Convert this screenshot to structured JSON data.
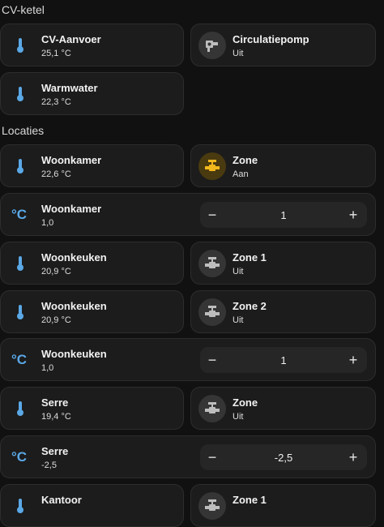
{
  "sections": {
    "cv_ketel": "CV-ketel",
    "locaties": "Locaties"
  },
  "cards": {
    "cv_aanvoer": {
      "name": "CV-Aanvoer",
      "state": "25,1 °C",
      "icon": "thermometer-icon"
    },
    "circulatiepomp": {
      "name": "Circulatiepomp",
      "state": "Uit",
      "icon": "pump-icon"
    },
    "warmwater": {
      "name": "Warmwater",
      "state": "22,3 °C",
      "icon": "thermometer-icon"
    },
    "woonkamer_temp": {
      "name": "Woonkamer",
      "state": "22,6 °C",
      "icon": "thermometer-icon"
    },
    "woonkamer_zone": {
      "name": "Zone",
      "state": "Aan",
      "icon": "valve-icon"
    },
    "woonkamer_offset": {
      "name": "Woonkamer",
      "state": "1,0",
      "icon": "celsius-icon",
      "value": "1"
    },
    "woonkeuken_temp1": {
      "name": "Woonkeuken",
      "state": "20,9 °C",
      "icon": "thermometer-icon"
    },
    "woonkeuken_zone1": {
      "name": "Zone 1",
      "state": "Uit",
      "icon": "valve-icon"
    },
    "woonkeuken_temp2": {
      "name": "Woonkeuken",
      "state": "20,9 °C",
      "icon": "thermometer-icon"
    },
    "woonkeuken_zone2": {
      "name": "Zone 2",
      "state": "Uit",
      "icon": "valve-icon"
    },
    "woonkeuken_offset": {
      "name": "Woonkeuken",
      "state": "1,0",
      "icon": "celsius-icon",
      "value": "1"
    },
    "serre_temp": {
      "name": "Serre",
      "state": "19,4 °C",
      "icon": "thermometer-icon"
    },
    "serre_zone": {
      "name": "Zone",
      "state": "Uit",
      "icon": "valve-icon"
    },
    "serre_offset": {
      "name": "Serre",
      "state": "-2,5",
      "icon": "celsius-icon",
      "value": "-2,5"
    },
    "kantoor_temp": {
      "name": "Kantoor",
      "state": "",
      "icon": "thermometer-icon"
    },
    "kantoor_zone": {
      "name": "Zone 1",
      "state": "",
      "icon": "valve-icon"
    }
  },
  "stepper": {
    "minus": "−",
    "plus": "+"
  },
  "celsius_glyph": "°C",
  "colors": {
    "accent_blue": "#5aa8e6",
    "on_yellow": "#f2b81c",
    "card_bg": "#1c1c1c",
    "page_bg": "#111111"
  }
}
